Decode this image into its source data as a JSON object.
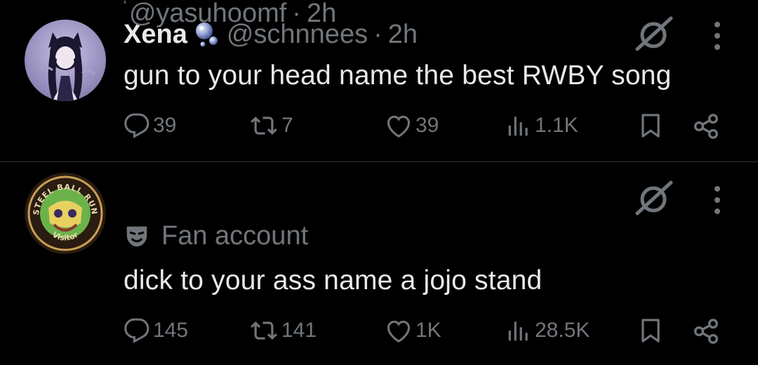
{
  "posts": [
    {
      "display_name": "Xena",
      "handle": "@schnnees",
      "separator": "·",
      "time": "2h",
      "text": "gun to your head name the best RWBY song",
      "stats": {
        "replies": "39",
        "reposts": "7",
        "likes": "39",
        "views": "1.1K"
      },
      "avatar": "anime-character-avatar"
    },
    {
      "prefix_mark": "'",
      "handle": "@yasuhoomf",
      "separator": "·",
      "time": "2h",
      "label": "Fan account",
      "text": "dick to your ass name a jojo stand",
      "stats": {
        "replies": "145",
        "reposts": "141",
        "likes": "1K",
        "views": "28.5K"
      },
      "avatar": "steel-ball-run-badge-avatar",
      "avatar_text_top": "STEEL BALL RUN",
      "avatar_text_bottom": "Visitor"
    }
  ],
  "colors": {
    "background": "#000000",
    "text": "#e7e9ea",
    "muted": "#71767b",
    "divider": "#2f3336"
  },
  "icons": [
    "reply-icon",
    "repost-icon",
    "like-icon",
    "views-icon",
    "bookmark-icon",
    "share-icon",
    "mute-icon",
    "more-icon",
    "mask-icon",
    "bubble-badge-icon"
  ]
}
